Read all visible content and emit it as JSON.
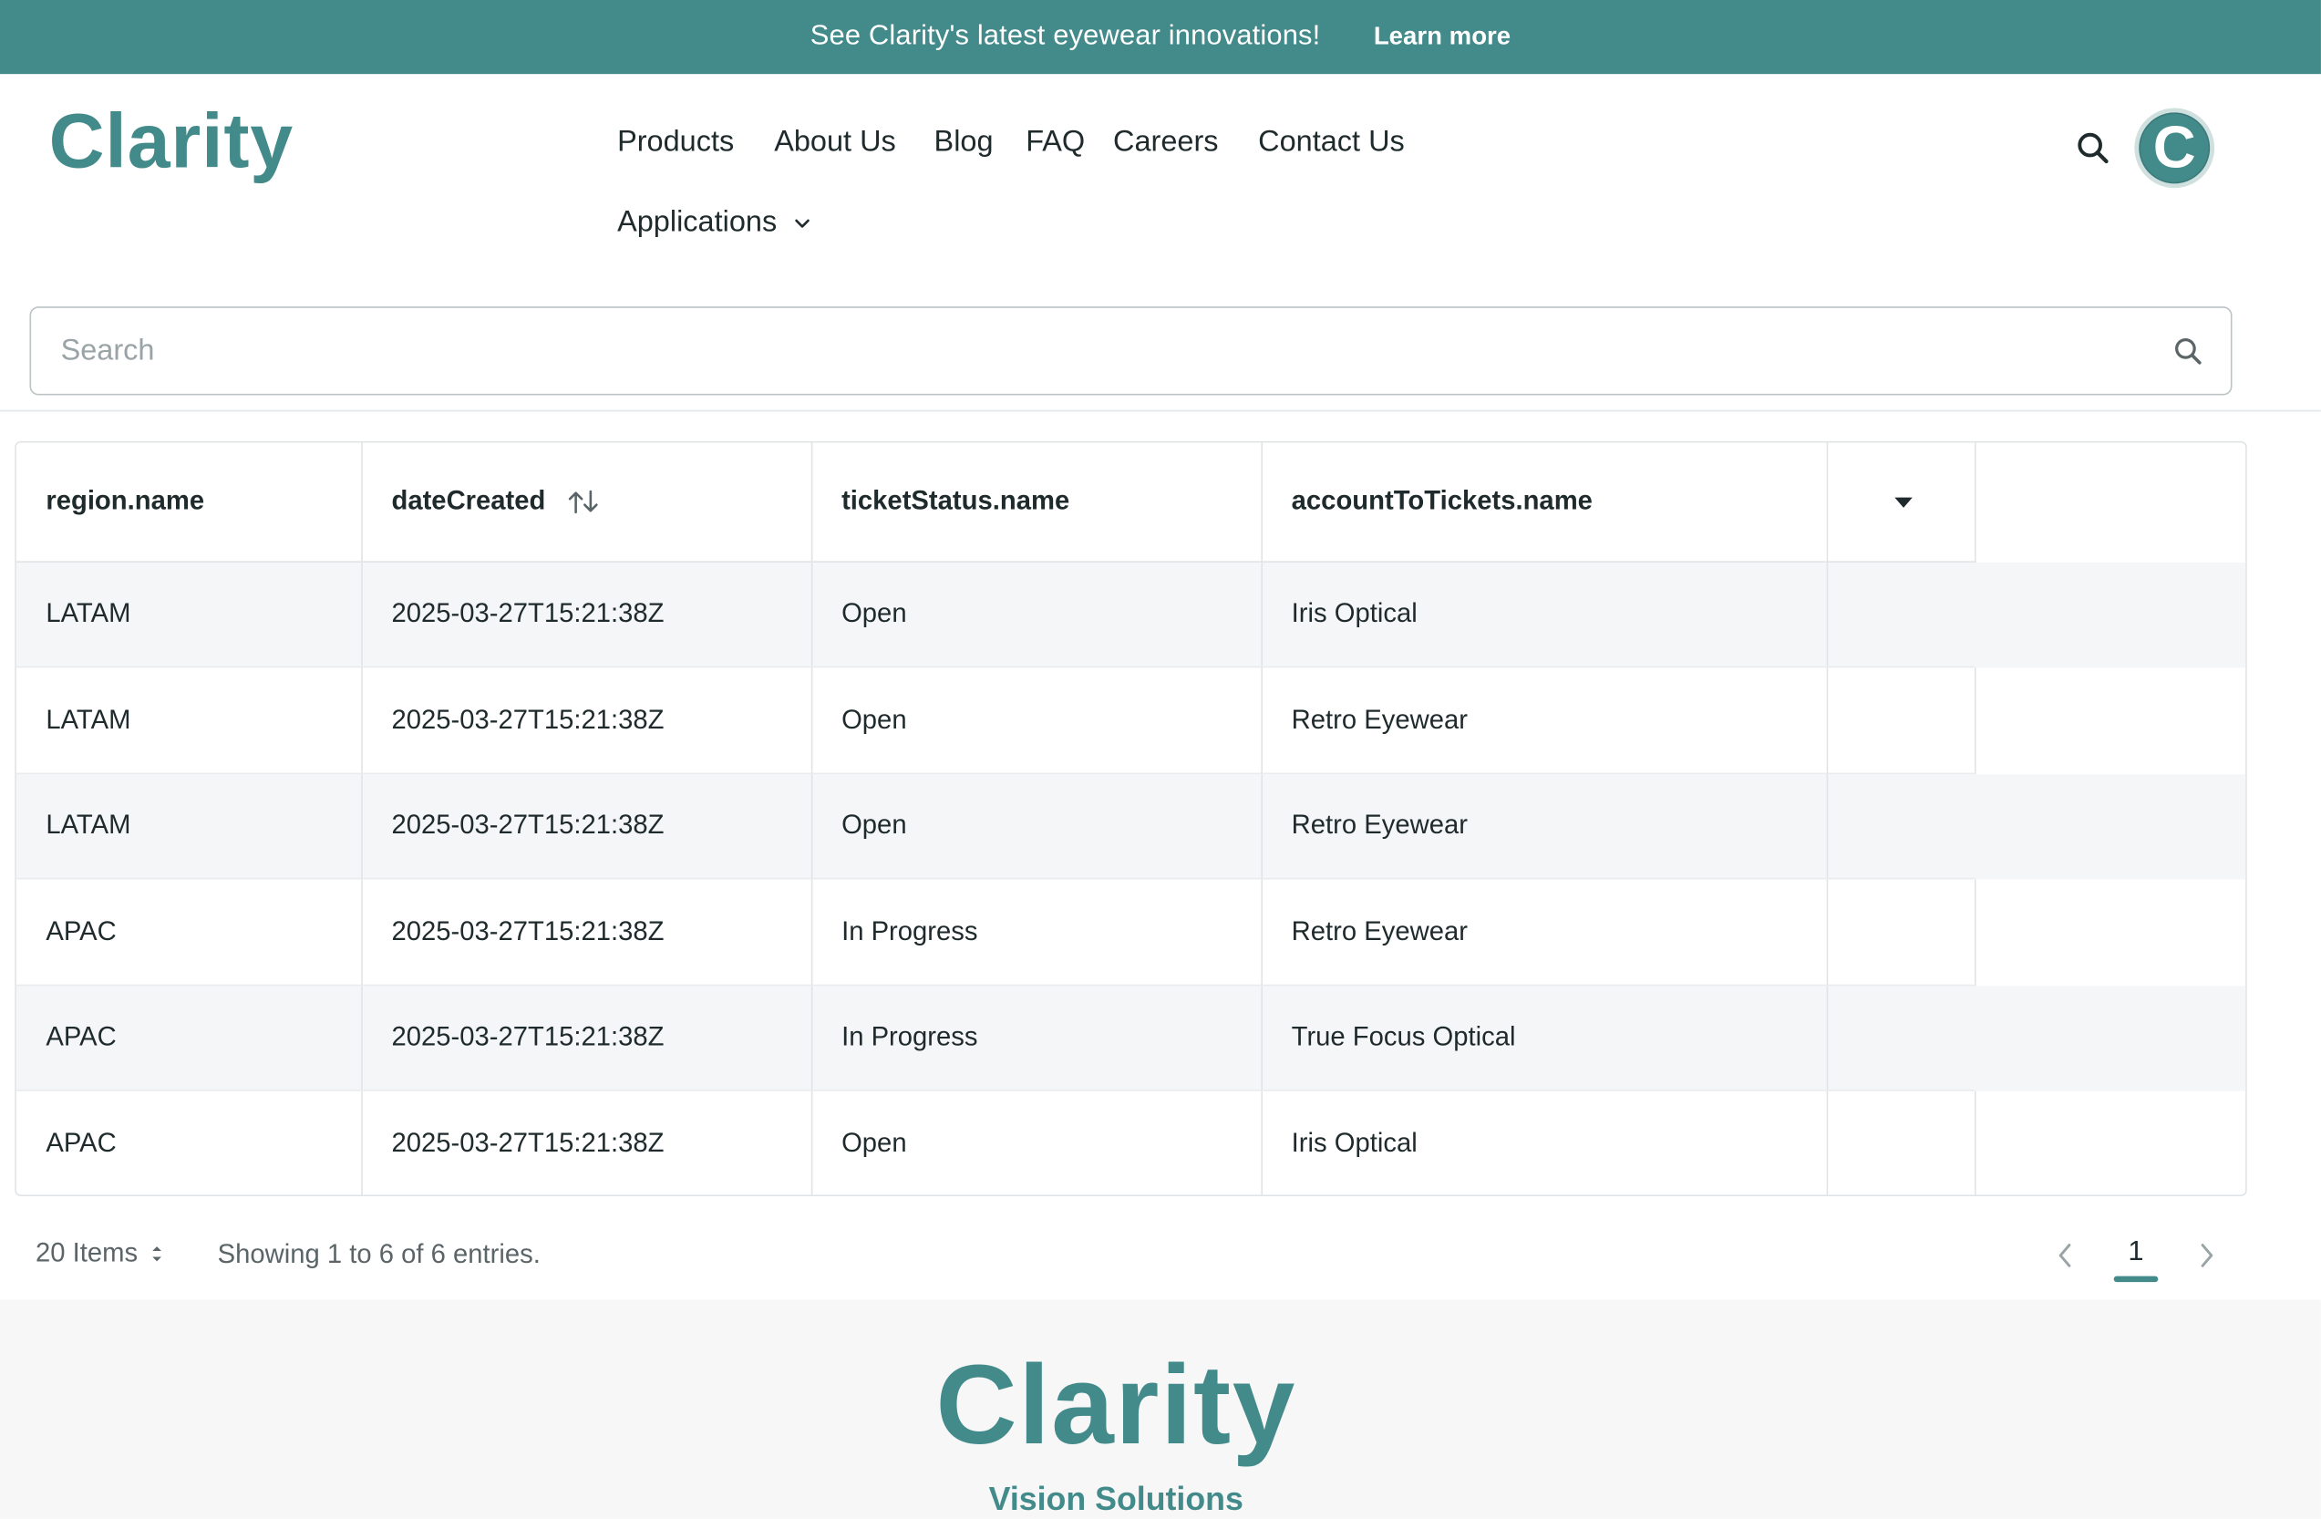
{
  "announcement": {
    "message": "See Clarity's latest eyewear innovations!",
    "link": "Learn more"
  },
  "header": {
    "logo": "Clarity",
    "nav": [
      "Products",
      "About Us",
      "Blog",
      "FAQ",
      "Careers",
      "Contact Us"
    ],
    "applications": "Applications",
    "avatar_letter": "C",
    "search_icon": "search-icon"
  },
  "search": {
    "placeholder": "Search",
    "value": ""
  },
  "table": {
    "columns": [
      "region.name",
      "dateCreated",
      "ticketStatus.name",
      "accountToTickets.name"
    ],
    "rows": [
      [
        "LATAM",
        "2025-03-27T15:21:38Z",
        "Open",
        "Iris Optical"
      ],
      [
        "LATAM",
        "2025-03-27T15:21:38Z",
        "Open",
        "Retro Eyewear"
      ],
      [
        "LATAM",
        "2025-03-27T15:21:38Z",
        "Open",
        "Retro Eyewear"
      ],
      [
        "APAC",
        "2025-03-27T15:21:38Z",
        "In Progress",
        "Retro Eyewear"
      ],
      [
        "APAC",
        "2025-03-27T15:21:38Z",
        "In Progress",
        "True Focus Optical"
      ],
      [
        "APAC",
        "2025-03-27T15:21:38Z",
        "Open",
        "Iris Optical"
      ]
    ]
  },
  "pagination": {
    "items_per_page": "20 Items",
    "summary": "Showing 1 to 6 of 6 entries.",
    "current_page": "1"
  },
  "footer": {
    "logo": "Clarity",
    "tagline": "Vision Solutions"
  },
  "colors": {
    "brand": "#438a8a",
    "stripe": "#f5f6f7"
  }
}
